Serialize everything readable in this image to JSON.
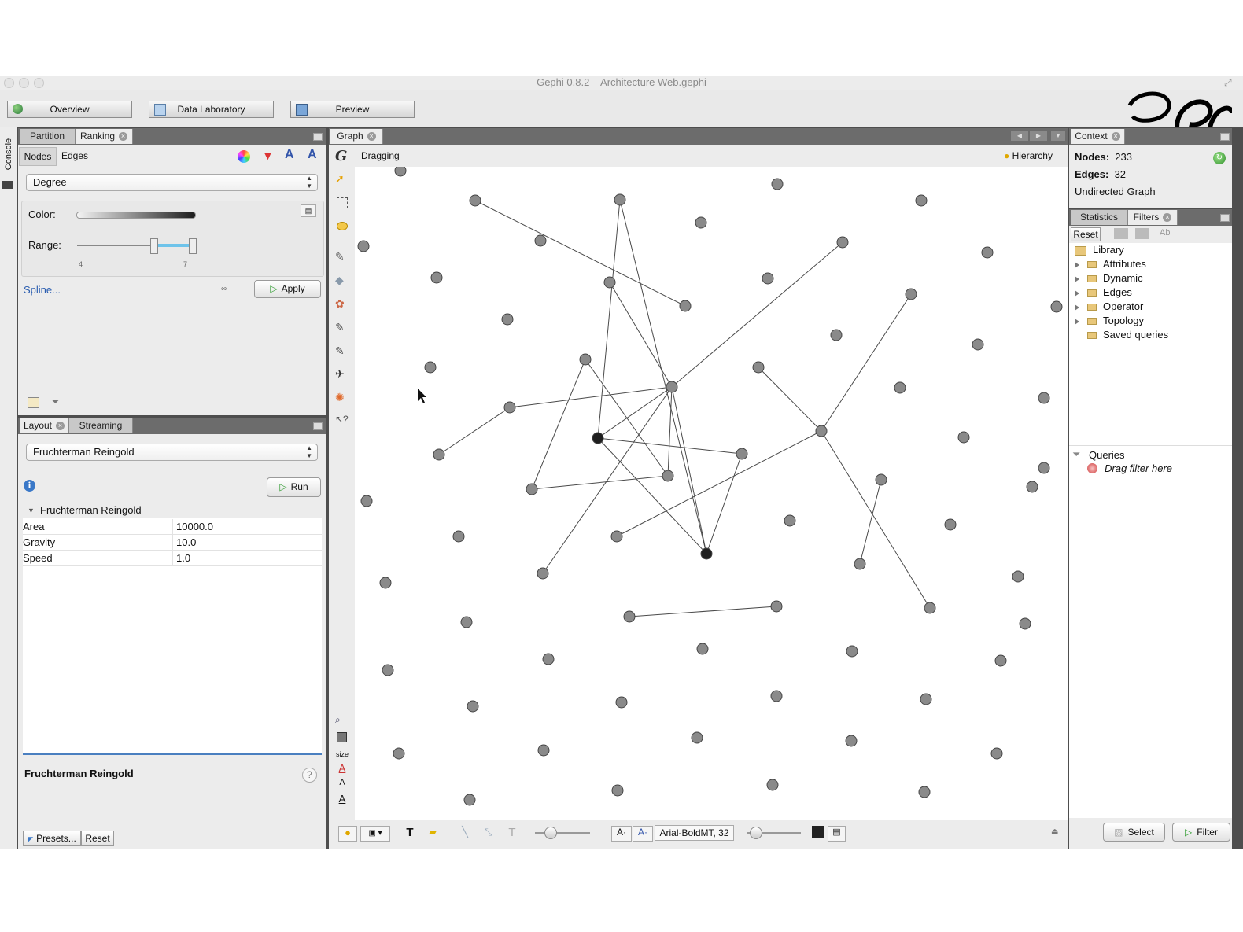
{
  "window": {
    "title": "Gephi 0.8.2 – Architecture Web.gephi"
  },
  "modes": [
    {
      "label": "Overview"
    },
    {
      "label": "Data Laboratory"
    },
    {
      "label": "Preview"
    }
  ],
  "console_label": "Console",
  "ranking_panel": {
    "tabs": [
      "Partition",
      "Ranking"
    ],
    "subtabs": [
      "Nodes",
      "Edges"
    ],
    "attribute": "Degree",
    "color_label": "Color:",
    "range_label": "Range:",
    "range_min": "4",
    "range_max": "7",
    "spline_link": "Spline...",
    "apply_label": "Apply"
  },
  "layout_panel": {
    "tabs": [
      "Layout",
      "Streaming"
    ],
    "algorithm": "Fruchterman Reingold",
    "run_label": "Run",
    "section_title": "Fruchterman Reingold",
    "properties": [
      {
        "name": "Area",
        "value": "10000.0"
      },
      {
        "name": "Gravity",
        "value": "10.0"
      },
      {
        "name": "Speed",
        "value": "1.0"
      }
    ],
    "description_title": "Fruchterman Reingold",
    "presets_label": "Presets...",
    "reset_label": "Reset"
  },
  "graph_panel": {
    "tab": "Graph",
    "mode_label": "Dragging",
    "hierarchy_label": "Hierarchy",
    "size_label": "size",
    "font_label": "Arial-BoldMT, 32"
  },
  "context_panel": {
    "tab": "Context",
    "nodes_label": "Nodes:",
    "nodes_value": "233",
    "edges_label": "Edges:",
    "edges_value": "32",
    "graph_type": "Undirected Graph"
  },
  "filters_panel": {
    "tabs": [
      "Statistics",
      "Filters"
    ],
    "reset_label": "Reset",
    "library_label": "Library",
    "library_items": [
      "Attributes",
      "Dynamic",
      "Edges",
      "Operator",
      "Topology",
      "Saved queries"
    ],
    "queries_label": "Queries",
    "drag_hint": "Drag filter here",
    "select_label": "Select",
    "filter_label": "Filter"
  },
  "colors": {
    "node": "#8a8a8a",
    "node_selected": "#1f1f1f",
    "edge": "#4a4a4a",
    "tabbar": "#6c6c6c"
  },
  "icons": [
    "globe-icon",
    "table-icon",
    "monitor-icon",
    "lightbulb-icon",
    "play-icon",
    "info-icon",
    "help-icon",
    "folder-icon",
    "funnel-icon"
  ]
}
